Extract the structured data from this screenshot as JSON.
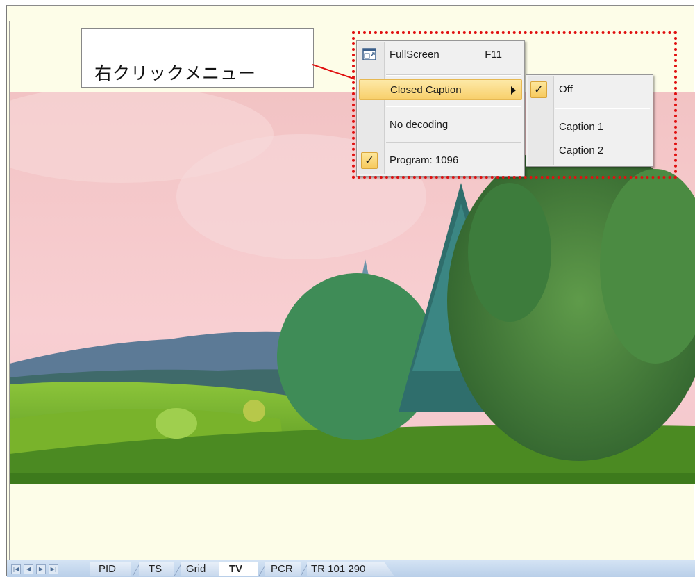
{
  "callout": {
    "text": "右クリックメニュー"
  },
  "context_menu": {
    "items": [
      {
        "label": "FullScreen",
        "shortcut": "F11",
        "icon": "fullscreen-icon"
      },
      {
        "label": "Closed Caption",
        "submenu": true
      },
      {
        "label": "No decoding"
      },
      {
        "label": "Program: 1096",
        "checked": true
      }
    ]
  },
  "caption_submenu": {
    "items": [
      {
        "label": "Off",
        "checked": true
      },
      {
        "label": "Caption 1"
      },
      {
        "label": "Caption 2"
      }
    ]
  },
  "tabs": {
    "items": [
      "PID",
      "TS",
      "Grid",
      "TV",
      "PCR",
      "TR 101 290"
    ],
    "active": "TV"
  },
  "colors": {
    "highlight": "#f8cf6a",
    "callout_border": "#e01010",
    "tabbar": "#b9cfe9"
  }
}
